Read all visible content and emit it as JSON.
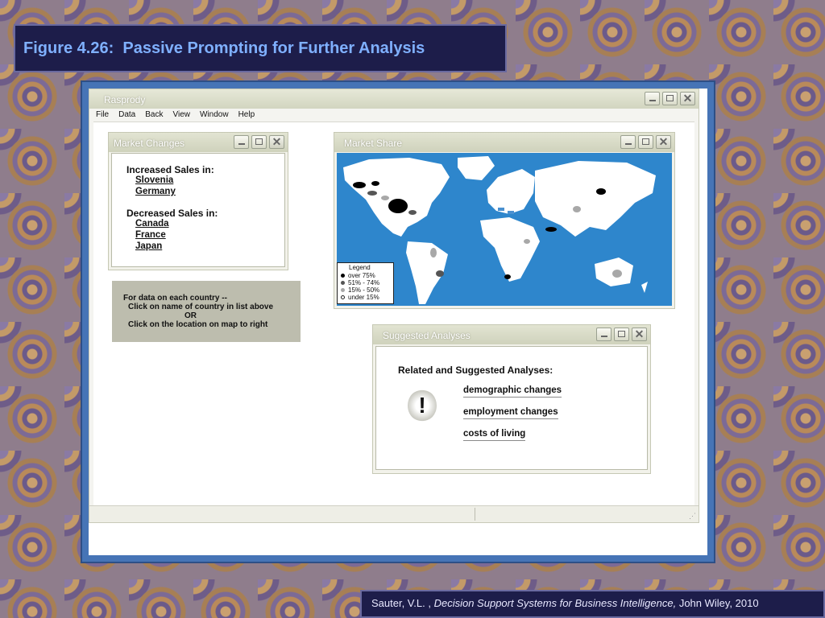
{
  "slide": {
    "title": "Figure 4.26:  Passive Prompting for Further Analysis",
    "citation": {
      "author": "Sauter, V.L. ,",
      "book": "Decision Support Systems for Business Intelligence,",
      "publisher": "John Wiley, 2010"
    }
  },
  "app": {
    "title": "Rasprody",
    "menu": [
      "File",
      "Data",
      "Back",
      "View",
      "Window",
      "Help"
    ],
    "window_buttons": {
      "minimize": "_",
      "maximize": "□",
      "close": "✕"
    }
  },
  "market_changes": {
    "title": "Market Changes",
    "increased_heading": "Increased Sales in:",
    "increased": [
      "Slovenia",
      "Germany"
    ],
    "decreased_heading": "Decreased Sales in:",
    "decreased": [
      "Canada",
      "France",
      "Japan"
    ]
  },
  "hint": {
    "line1": "For data on each country --",
    "line2": "Click on name of country in list above",
    "line3": "OR",
    "line4": "Click on the location on map to right"
  },
  "market_share": {
    "title": "Market Share",
    "legend": {
      "title": "Legend",
      "items": [
        {
          "label": "over 75%",
          "color": "#000000"
        },
        {
          "label": "51% - 74%",
          "color": "#555555"
        },
        {
          "label": "15% - 50%",
          "color": "#a8a8a8"
        },
        {
          "label": "under 15%",
          "color": "#ffffff"
        }
      ]
    },
    "colors": {
      "ocean": "#2e86cc",
      "land": "#ffffff"
    }
  },
  "suggested": {
    "title": "Suggested Analyses",
    "heading": "Related and Suggested Analyses:",
    "icon": "exclamation-icon",
    "items": [
      "demographic changes",
      "employment changes",
      "costs of living"
    ]
  }
}
